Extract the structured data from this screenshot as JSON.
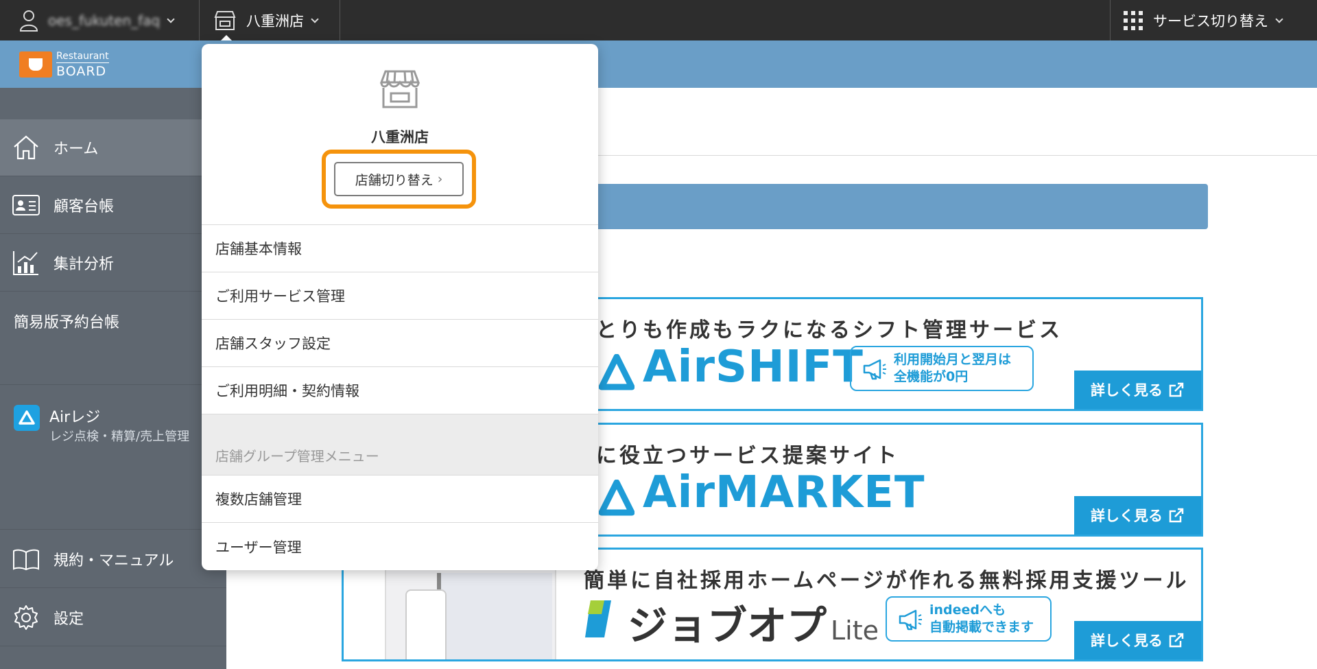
{
  "topbar": {
    "username": "oes_fukuten_faq",
    "store_name": "八重洲店",
    "service_switch_label": "サービス切り替え"
  },
  "logo": {
    "line1": "Restaurant",
    "line2": "BOARD"
  },
  "sidebar": {
    "items": [
      {
        "label": "ホーム",
        "icon": "home-icon"
      },
      {
        "label": "顧客台帳",
        "icon": "id-card-icon"
      },
      {
        "label": "集計分析",
        "icon": "chart-icon"
      },
      {
        "label": "簡易版予約台帳"
      }
    ],
    "airregi": {
      "title": "Airレジ",
      "subtitle": "レジ点検・精算/売上管理"
    },
    "bottom_items": [
      {
        "label": "規約・マニュアル",
        "icon": "book-icon"
      },
      {
        "label": "設定",
        "icon": "gear-icon"
      }
    ]
  },
  "popover": {
    "store_name": "八重洲店",
    "switch_button": "店舗切り替え",
    "menu": [
      "店舗基本情報",
      "ご利用サービス管理",
      "店舗スタッフ設定",
      "ご利用明細・契約情報"
    ],
    "group_header": "店舗グループ管理メニュー",
    "group_menu": [
      "複数店舗管理",
      "ユーザー管理"
    ]
  },
  "banners": [
    {
      "catch": "やりとりも作成もラクになるシフト管理サービス",
      "product": "AirSHIFT",
      "bubble_line1": "利用開始月と翌月は",
      "bubble_line2": "全機能が0円",
      "button": "詳しく見る"
    },
    {
      "catch": "お店に役立つサービス提案サイト",
      "product": "AirMARKET",
      "button": "詳しく見る"
    },
    {
      "catch": "簡単に自社採用ホームページが作れる無料採用支援ツール",
      "product": "ジョブオプ",
      "product_suffix": "Lite",
      "bubble_line1": "indeedへも",
      "bubble_line2": "自動掲載できます",
      "button": "詳しく見る"
    }
  ],
  "colors": {
    "topbar": "#2d2d2d",
    "brand_blue": "#6a9ec7",
    "sidebar": "#5f6770",
    "highlight": "#f5930c",
    "air_blue": "#1e9cd7"
  }
}
